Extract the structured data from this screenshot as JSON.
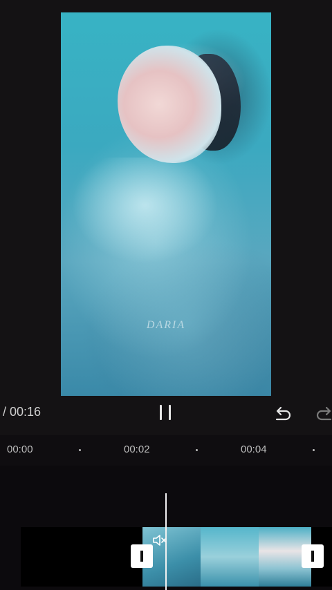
{
  "preview": {
    "watermark": "DARIA"
  },
  "controls": {
    "time_readout": "/ 00:16",
    "pause_label": "pause",
    "undo_label": "undo",
    "redo_label": "redo"
  },
  "ruler": {
    "labels": [
      "00:00",
      "00:02",
      "00:04"
    ]
  },
  "timeline": {
    "clip_muted": true
  },
  "icons": {
    "pause": "pause-icon",
    "undo": "undo-icon",
    "redo": "redo-icon",
    "mute": "speaker-muted-icon",
    "trim_left": "trim-handle-left",
    "trim_right": "trim-handle-right"
  },
  "colors": {
    "background": "#141214",
    "accent": "#ffffff",
    "video_tint": "#3ab0c3"
  }
}
